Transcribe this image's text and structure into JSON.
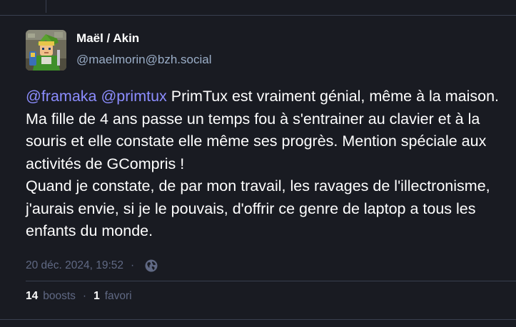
{
  "post": {
    "display_name": "Maël / Akin",
    "account": "@maelmorin@bzh.social",
    "avatar": "zelda-link-avatar",
    "content": {
      "mention1": "@framaka",
      "mention2": "@primtux",
      "text_line1": " PrimTux est vraiment génial, même à la maison. Ma fille de 4 ans passe un temps fou à s'entrainer au clavier et à la souris et elle constate elle même ses progrès. Mention spéciale aux activités de GCompris !",
      "paragraph2": "Quand je constate, de par mon travail, les ravages de l'illectronisme, j'aurais envie, si je le pouvais, d'offrir ce genre de laptop a tous les enfants du monde."
    },
    "timestamp": "20 déc. 2024, 19:52",
    "separator": "·",
    "visibility_icon": "globe-icon",
    "boosts_count": "14",
    "boosts_label": "boosts",
    "favourites_count": "1",
    "favourites_label": "favori"
  },
  "colors": {
    "background": "#191b22",
    "mention": "#8c8dff",
    "secondary_text": "#9baec8",
    "muted": "#606984",
    "divider": "#393f4f"
  }
}
